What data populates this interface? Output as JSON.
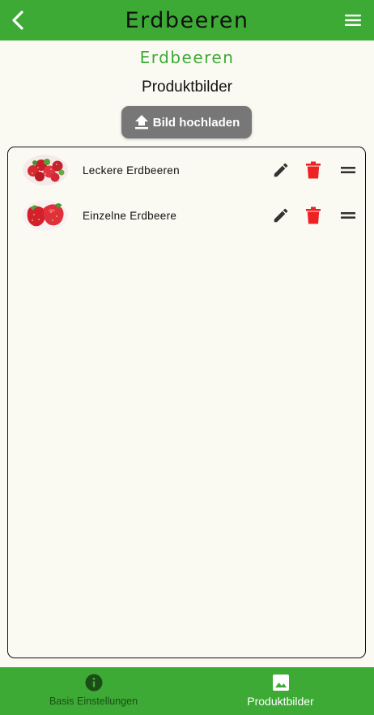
{
  "header": {
    "title": "Erdbeeren",
    "back_icon": "chevron-left-icon",
    "menu_icon": "hamburger-menu-icon"
  },
  "product_name": "Erdbeeren",
  "section_title": "Produktbilder",
  "upload_button": {
    "label": "Bild hochladen",
    "icon": "upload-icon"
  },
  "images": [
    {
      "label": "Leckere Erdbeeren",
      "thumbnail": "strawberries-bowl-photo"
    },
    {
      "label": "Einzelne Erdbeere",
      "thumbnail": "single-strawberry-photo"
    }
  ],
  "row_actions": {
    "edit_icon": "pencil-icon",
    "delete_icon": "trash-icon",
    "drag_icon": "drag-handle-icon"
  },
  "bottom_nav": {
    "items": [
      {
        "label": "Basis Einstellungen",
        "icon": "info-icon",
        "active": false
      },
      {
        "label": "Produktbilder",
        "icon": "image-icon",
        "active": true
      }
    ]
  },
  "colors": {
    "primary_green": "#3daa35",
    "background": "#fafaf2",
    "button_gray": "#777777",
    "delete_red": "#ee2222",
    "nav_inactive": "#1b4d17"
  }
}
